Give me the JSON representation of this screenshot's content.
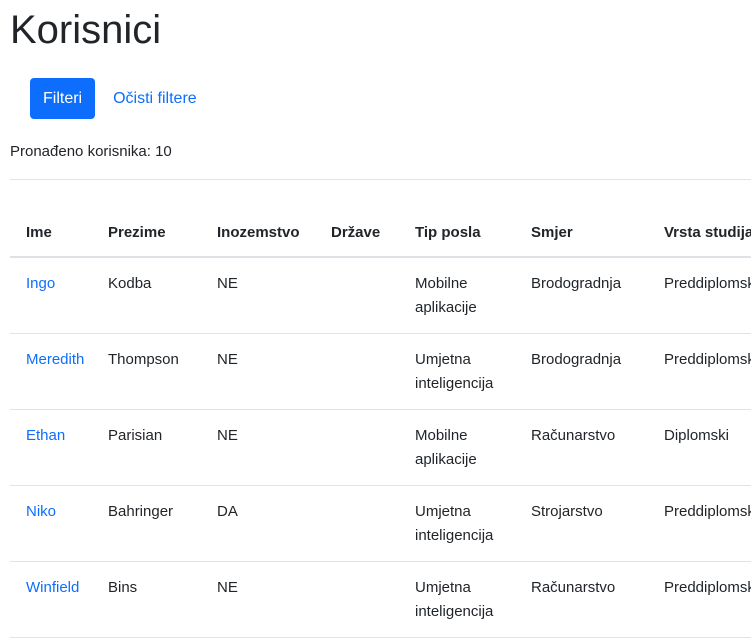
{
  "page": {
    "title": "Korisnici"
  },
  "actions": {
    "filters_label": "Filteri",
    "clear_label": "Očisti filtere"
  },
  "results": {
    "count_text": "Pronađeno korisnika: 10"
  },
  "table": {
    "headers": [
      "Ime",
      "Prezime",
      "Inozemstvo",
      "Države",
      "Tip posla",
      "Smjer",
      "Vrsta studija"
    ],
    "rows": [
      {
        "ime": "Ingo",
        "prezime": "Kodba",
        "inozemstvo": "NE",
        "drzave": "",
        "tip_posla": "Mobilne aplikacije",
        "smjer": "Brodogradnja",
        "vrsta": "Preddiplomski"
      },
      {
        "ime": "Meredith",
        "prezime": "Thompson",
        "inozemstvo": "NE",
        "drzave": "",
        "tip_posla": "Umjetna inteligencija",
        "smjer": "Brodogradnja",
        "vrsta": "Preddiplomski"
      },
      {
        "ime": "Ethan",
        "prezime": "Parisian",
        "inozemstvo": "NE",
        "drzave": "",
        "tip_posla": "Mobilne aplikacije",
        "smjer": "Računarstvo",
        "vrsta": "Diplomski"
      },
      {
        "ime": "Niko",
        "prezime": "Bahringer",
        "inozemstvo": "DA",
        "drzave": "",
        "tip_posla": "Umjetna inteligencija",
        "smjer": "Strojarstvo",
        "vrsta": "Preddiplomski"
      },
      {
        "ime": "Winfield",
        "prezime": "Bins",
        "inozemstvo": "NE",
        "drzave": "",
        "tip_posla": "Umjetna inteligencija",
        "smjer": "Računarstvo",
        "vrsta": "Preddiplomski"
      }
    ]
  },
  "colors": {
    "primary": "#0d6efd",
    "text": "#212529",
    "border": "#dee2e6"
  }
}
